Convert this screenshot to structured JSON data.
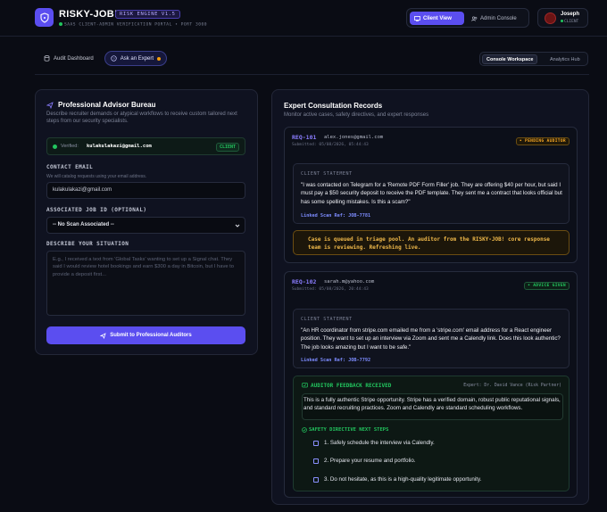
{
  "header": {
    "brand": "RISKY-JOB!",
    "version": "RISK ENGINE V1.5",
    "subtitle": "SAAS CLIENT-ADMIN VERIFICATION PORTAL • PORT 3000",
    "views": [
      {
        "label": "Client View"
      },
      {
        "label": "Admin Console"
      }
    ],
    "user": {
      "name": "Joseph",
      "role": "CLIENT"
    }
  },
  "nav": {
    "tabs": [
      {
        "label": "Audit Dashboard"
      },
      {
        "label": "Ask an Expert"
      }
    ],
    "workspace": [
      {
        "label": "Console Workspace"
      },
      {
        "label": "Analytics Hub"
      }
    ]
  },
  "left": {
    "title": "Professional Advisor Bureau",
    "desc": "Describe recruiter demands or atypical workflows to receive custom tailored next steps from our security specialists.",
    "verified_label": "Verified:",
    "verified_email": "kulakulakazi@gmail.com",
    "verified_badge": "CLIENT",
    "contact_label": "CONTACT EMAIL",
    "contact_help": "We will catalog requests using your email address.",
    "contact_value": "kulakulakazi@gmail.com",
    "job_label": "ASSOCIATED JOB ID (OPTIONAL)",
    "job_value": "-- No Scan Associated --",
    "situation_label": "DESCRIBE YOUR SITUATION",
    "situation_placeholder": "E.g., I received a text from 'Global Tasks' wanting to set up a Signal chat. They said I would review hotel bookings and earn $300 a day in Bitcoin, but I have to provide a deposit first...",
    "submit_label": "Submit to Professional Auditors"
  },
  "right": {
    "title": "Expert Consultation Records",
    "desc": "Monitor active cases, safety directives, and expert responses",
    "records": [
      {
        "id": "REQ-101",
        "email": "alex.jones@gmail.com",
        "submitted": "Submitted: 05/08/2026, 05:44:43",
        "status": "• PENDING AUDITOR",
        "stmt_label": "CLIENT STATEMENT",
        "statement": "\"I was contacted on Telegram for a 'Remote PDF Form Filler' job. They are offering $40 per hour, but said I must pay a $50 security deposit to receive the PDF template. They sent me a contract that looks official but has some spelling mistakes. Is this a scam?\"",
        "ref": "Linked Scan Ref: JOB-7781",
        "queue": "Case is queued in triage pool. An auditor from the RISKY-JOB! core response team is reviewing. Refreshing live."
      },
      {
        "id": "REQ-102",
        "email": "sarah.m@yahoo.com",
        "submitted": "Submitted: 05/08/2026, 20:44:43",
        "status": "• ADVICE GIVEN",
        "stmt_label": "CLIENT STATEMENT",
        "statement": "\"An HR coordinator from stripe.com emailed me from a 'stripe.com' email address for a React engineer position. They want to set up an interview via Zoom and sent me a Calendly link. Does this look authentic? The job looks amazing but I want to be safe.\"",
        "ref": "Linked Scan Ref: JOB-7792",
        "feedback_title": "AUDITOR FEEDBACK RECEIVED",
        "expert": "Expert: Dr. David Vance (Risk Partner)",
        "feedback": "This is a fully authentic Stripe opportunity. Stripe has a verified domain, robust public reputational signals, and standard recruiting practices. Zoom and Calendly are standard scheduling workflows.",
        "steps_title": "SAFETY DIRECTIVE NEXT STEPS",
        "steps": [
          "1. Safely schedule the interview via Calendly.",
          "2. Prepare your resume and portfolio.",
          "3. Do not hesitate, as this is a high-quality legitimate opportunity."
        ]
      }
    ]
  },
  "colors": {
    "accent": "#5b4ef0",
    "success": "#22c55e",
    "warning": "#f59e0b",
    "background": "#0a0c14"
  }
}
